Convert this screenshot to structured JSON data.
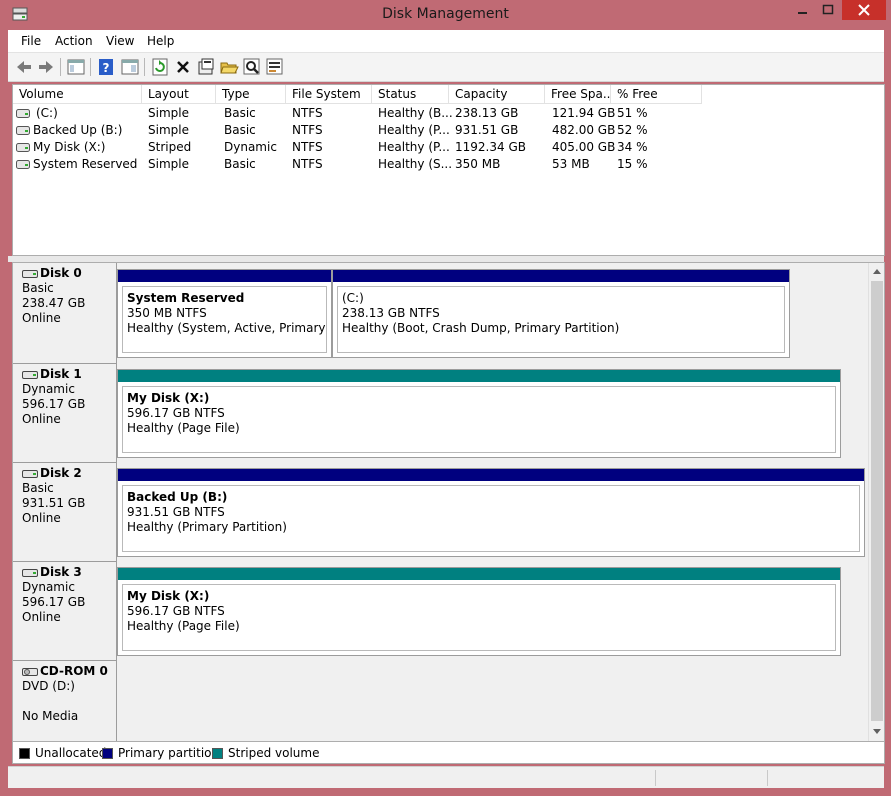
{
  "window": {
    "title": "Disk Management"
  },
  "menu": [
    {
      "label": "File"
    },
    {
      "label": "Action"
    },
    {
      "label": "View"
    },
    {
      "label": "Help"
    }
  ],
  "toolbar": {
    "icons": [
      "back-arrow-icon",
      "forward-arrow-icon",
      "console-tree-icon",
      "help-icon",
      "show-pane-icon",
      "refresh-icon",
      "delete-icon",
      "properties-icon",
      "open-folder-icon",
      "search-icon",
      "settings-icon"
    ]
  },
  "volume_list": {
    "columns": [
      "Volume",
      "Layout",
      "Type",
      "File System",
      "Status",
      "Capacity",
      "Free Spa...",
      "% Free"
    ],
    "rows": [
      {
        "volume": "(C:)",
        "layout": "Simple",
        "type": "Basic",
        "fs": "NTFS",
        "status": "Healthy (B...",
        "capacity": "238.13 GB",
        "free": "121.94 GB",
        "pct": "51 %"
      },
      {
        "volume": "Backed Up (B:)",
        "layout": "Simple",
        "type": "Basic",
        "fs": "NTFS",
        "status": "Healthy (P...",
        "capacity": "931.51 GB",
        "free": "482.00 GB",
        "pct": "52 %"
      },
      {
        "volume": "My Disk (X:)",
        "layout": "Striped",
        "type": "Dynamic",
        "fs": "NTFS",
        "status": "Healthy (P...",
        "capacity": "1192.34 GB",
        "free": "405.00 GB",
        "pct": "34 %"
      },
      {
        "volume": "System Reserved",
        "layout": "Simple",
        "type": "Basic",
        "fs": "NTFS",
        "status": "Healthy (S...",
        "capacity": "350 MB",
        "free": "53 MB",
        "pct": "15 %"
      }
    ]
  },
  "disks": [
    {
      "name": "Disk 0",
      "type": "Basic",
      "size": "238.47 GB",
      "state": "Online",
      "partitions": [
        {
          "name": "System Reserved",
          "size": "350 MB NTFS",
          "status": "Healthy (System, Active, Primary Partiti",
          "kind": "primary"
        },
        {
          "name": "(C:)",
          "size": "238.13 GB NTFS",
          "status": "Healthy (Boot, Crash Dump, Primary Partition)",
          "kind": "primary"
        }
      ]
    },
    {
      "name": "Disk 1",
      "type": "Dynamic",
      "size": "596.17 GB",
      "state": "Online",
      "partitions": [
        {
          "name": "My Disk  (X:)",
          "size": "596.17 GB NTFS",
          "status": "Healthy (Page File)",
          "kind": "striped"
        }
      ]
    },
    {
      "name": "Disk 2",
      "type": "Basic",
      "size": "931.51 GB",
      "state": "Online",
      "partitions": [
        {
          "name": "Backed Up  (B:)",
          "size": "931.51 GB NTFS",
          "status": "Healthy (Primary Partition)",
          "kind": "primary"
        }
      ]
    },
    {
      "name": "Disk 3",
      "type": "Dynamic",
      "size": "596.17 GB",
      "state": "Online",
      "partitions": [
        {
          "name": "My Disk  (X:)",
          "size": "596.17 GB NTFS",
          "status": "Healthy (Page File)",
          "kind": "striped"
        }
      ]
    }
  ],
  "cdrom": {
    "name": "CD-ROM 0",
    "drive": "DVD (D:)",
    "state": "No Media"
  },
  "legend": [
    {
      "label": "Unallocated",
      "color": "#000000"
    },
    {
      "label": "Primary partition",
      "color": "#00007f"
    },
    {
      "label": "Striped volume",
      "color": "#008080"
    }
  ],
  "colors": {
    "primary": "#00007f",
    "striped": "#008080",
    "frame": "#c06a74",
    "close": "#c7302a"
  }
}
